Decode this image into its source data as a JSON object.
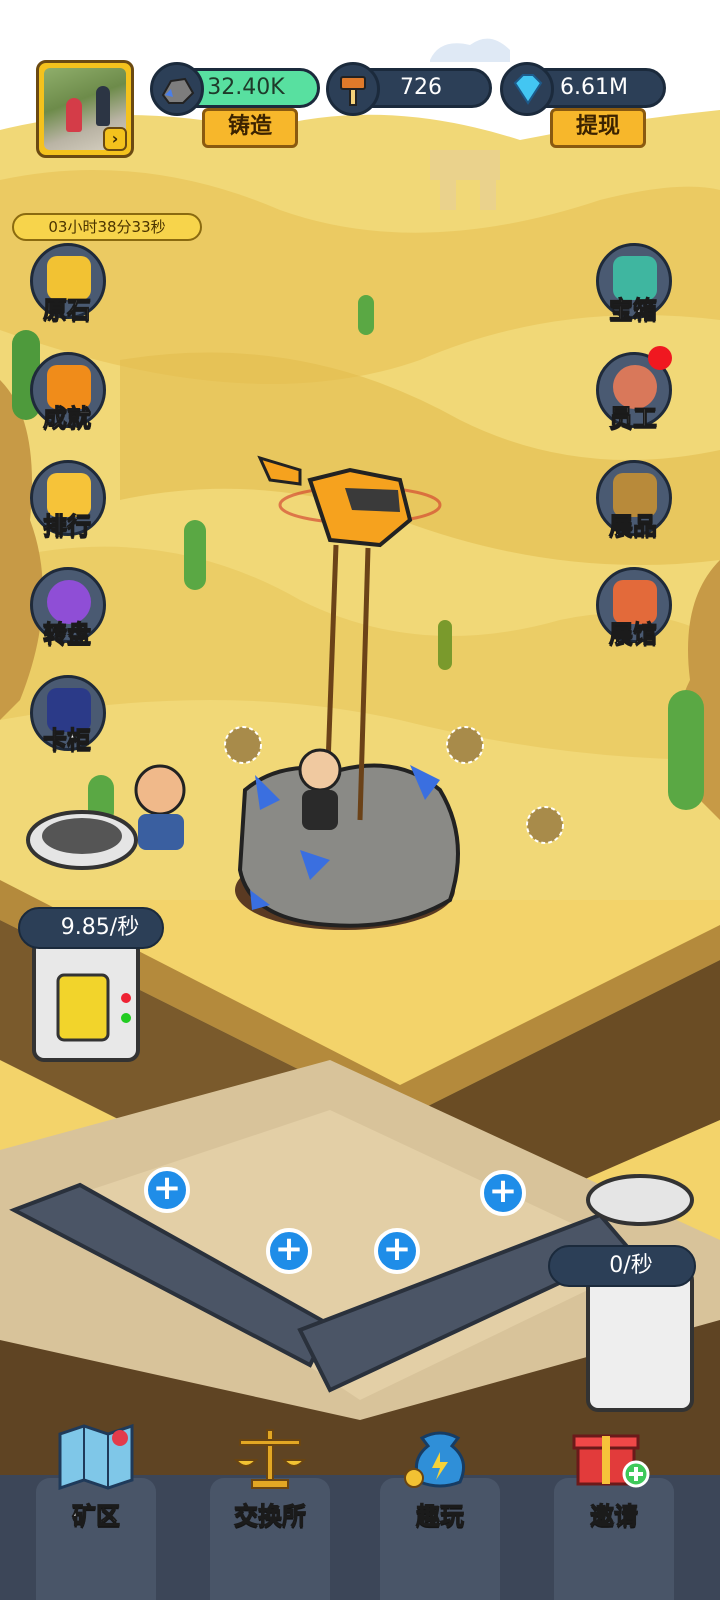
{
  "top_bar": {
    "ore_amount": "32.40K",
    "forge_label": "铸造",
    "hammer_amount": "726",
    "gem_amount": "6.61M",
    "withdraw_label": "提现"
  },
  "timer": "03小时38分33秒",
  "left_menu": [
    "原石",
    "成就",
    "排行",
    "转盘",
    "卡柜"
  ],
  "right_menu": [
    "宝箱",
    "员工",
    "展品",
    "展馆"
  ],
  "rates": {
    "mine_rate": "9.85/秒",
    "conveyor_rate": "0/秒"
  },
  "bottom_nav": [
    "矿区",
    "交换所",
    "趣玩",
    "邀请"
  ],
  "colors": {
    "sand": "#f3d36a",
    "panel": "#2c3f57",
    "accent_green": "#58e0a0",
    "button_yellow": "#f7b72b",
    "plus_blue": "#1f8de8",
    "notification_red": "#f01820"
  }
}
